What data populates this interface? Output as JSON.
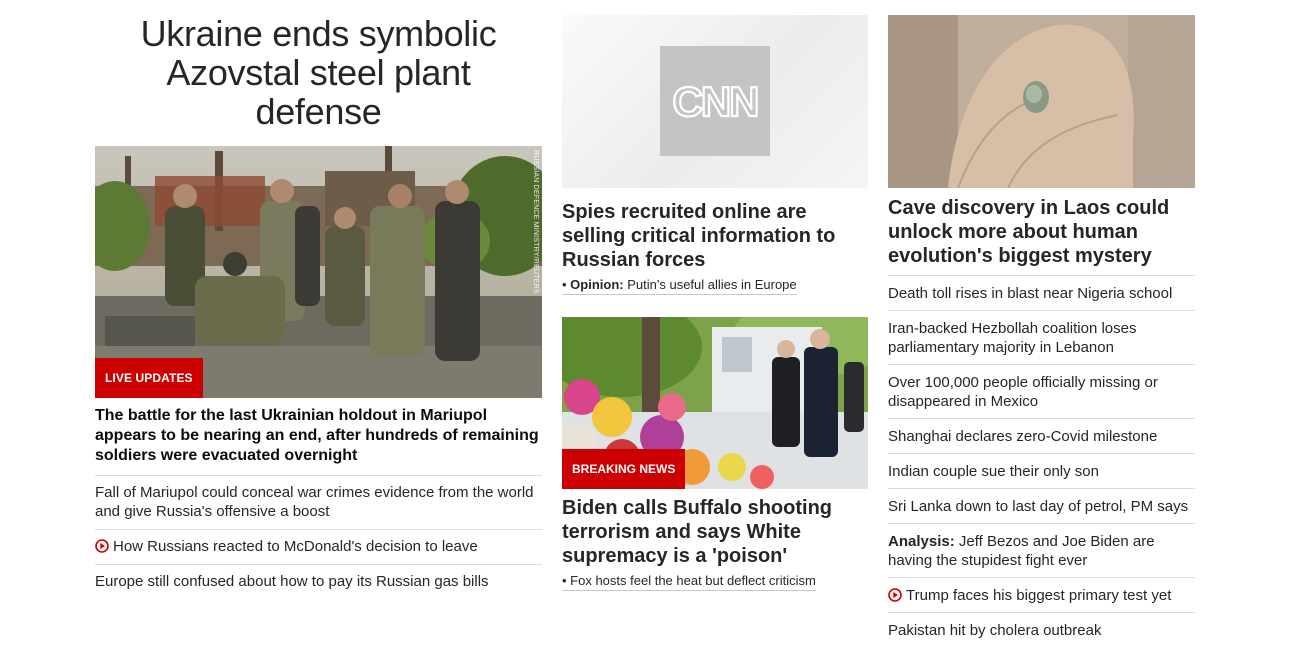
{
  "col1": {
    "headline": "Ukraine ends symbolic Azovstal steel plant defense",
    "photo_credit": "RUSSIAN DEFENCE MINISTRY/REUTERS",
    "badge": "LIVE UPDATES",
    "blurb": "The battle for the last Ukrainian holdout in Mariupol appears to be nearing an end, after hundreds of remaining soldiers were evacuated overnight",
    "links": [
      "Fall of Mariupol could conceal war crimes evidence from the world and give Russia's offensive a boost",
      "How Russians reacted to McDonald's decision to leave",
      "Europe still confused about how to pay its Russian gas bills"
    ]
  },
  "col2": {
    "story1": {
      "logo_text": "CNN",
      "title": "Spies recruited online are selling critical information to Russian forces",
      "sub_prefix": "Opinion:",
      "sub_text": "Putin's useful allies in Europe"
    },
    "story2": {
      "badge": "BREAKING NEWS",
      "title": "Biden calls Buffalo shooting terrorism and says White supremacy is a 'poison'",
      "sub_text": "Fox hosts feel the heat but deflect criticism"
    }
  },
  "col3": {
    "title": "Cave discovery in Laos could unlock more about human evolution's biggest mystery",
    "links": [
      {
        "text": "Death toll rises in blast near Nigeria school"
      },
      {
        "text": "Iran-backed Hezbollah coalition loses parliamentary majority in Lebanon"
      },
      {
        "text": "Over 100,000 people officially missing or disappeared in Mexico"
      },
      {
        "text": "Shanghai declares zero-Covid milestone"
      },
      {
        "text": "Indian couple sue their only son"
      },
      {
        "text": "Sri Lanka down to last day of petrol, PM says"
      },
      {
        "prefix": "Analysis:",
        "text": "Jeff Bezos and Joe Biden are having the stupidest fight ever"
      },
      {
        "text": "Trump faces his biggest primary test yet"
      },
      {
        "text": "Pakistan hit by cholera outbreak"
      }
    ]
  },
  "icons": {
    "video": "play-circle-icon"
  },
  "colors": {
    "badge_red": "#cc0000",
    "video_icon": "#cc0000"
  }
}
